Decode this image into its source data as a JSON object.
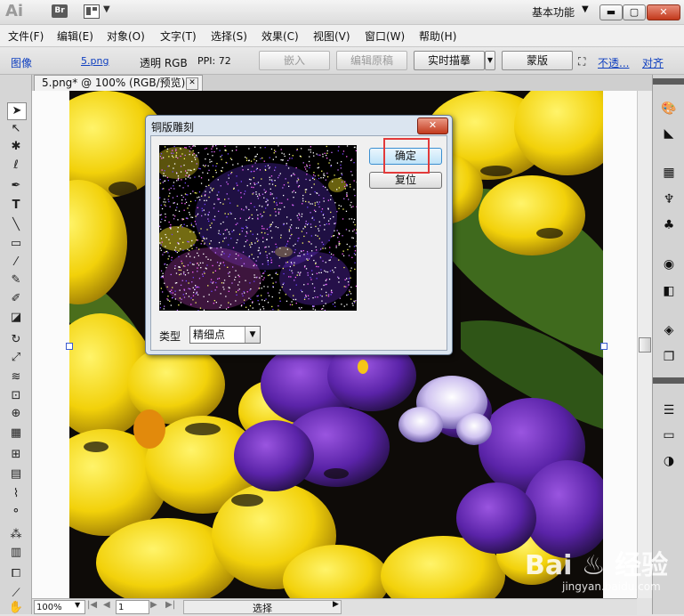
{
  "app": {
    "logo": "Ai",
    "bridge": "Br",
    "workspace": "基本功能"
  },
  "window_controls": {
    "minimize": "▬",
    "restore": "▢",
    "close": "✕"
  },
  "menu": [
    "文件(F)",
    "编辑(E)",
    "对象(O)",
    "文字(T)",
    "选择(S)",
    "效果(C)",
    "视图(V)",
    "窗口(W)",
    "帮助(H)"
  ],
  "control_bar": {
    "object_type": "图像",
    "file_link": "5.png",
    "color_info": "透明 RGB",
    "ppi": "PPI: 72",
    "embed": "嵌入",
    "edit_original": "编辑原稿",
    "live_trace": "实时描摹",
    "mask": "蒙版",
    "opacity_link": "不透...",
    "align_link": "对齐"
  },
  "document_tab": {
    "title": "5.png* @ 100% (RGB/预览)",
    "close": "✕"
  },
  "dialog": {
    "title": "铜版雕刻",
    "close": "✕",
    "ok": "确定",
    "reset": "复位",
    "type_label": "类型",
    "type_value": "精细点"
  },
  "status_bar": {
    "zoom": "100%",
    "page": "1",
    "mode": "选择"
  },
  "tools": [
    "selection-icon",
    "direct-selection-icon",
    "magic-wand-icon",
    "lasso-icon",
    "pen-icon",
    "type-icon",
    "line-icon",
    "rectangle-icon",
    "paintbrush-icon",
    "pencil-icon",
    "blob-brush-icon",
    "eraser-icon",
    "rotate-icon",
    "scale-icon",
    "warp-icon",
    "free-transform-icon",
    "shape-builder-icon",
    "perspective-icon",
    "mesh-icon",
    "gradient-icon",
    "eyedropper-icon",
    "blend-icon",
    "symbol-sprayer-icon",
    "graph-icon",
    "artboard-icon",
    "slice-icon",
    "hand-icon",
    "zoom-icon"
  ],
  "colors": {
    "accent_red": "#e23a3a",
    "link_blue": "#1040c0"
  },
  "watermark": {
    "logo": "Bai du 经验",
    "url": "jingyan.baidu.com"
  }
}
